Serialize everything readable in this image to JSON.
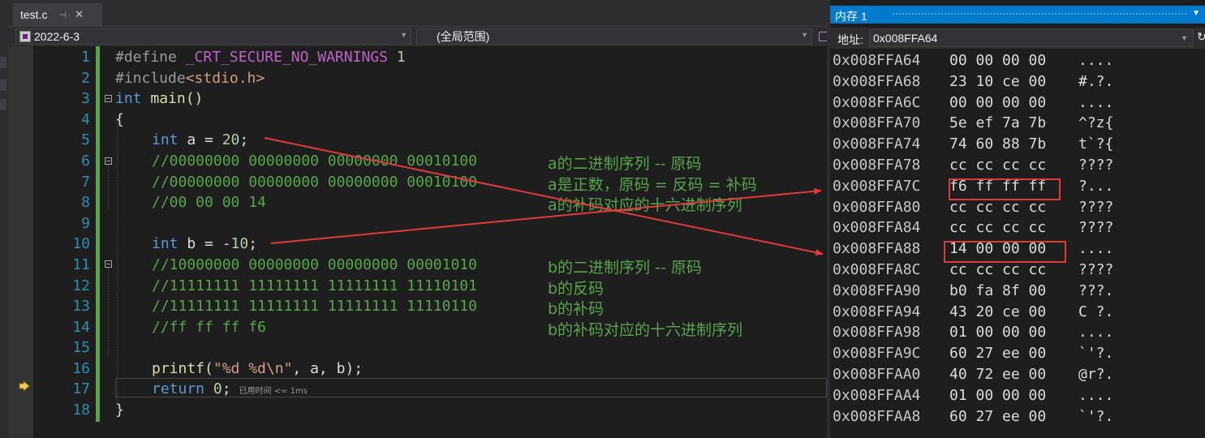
{
  "tab": {
    "filename": "test.c",
    "pin_icon": "pin-icon",
    "close_icon": "close-icon"
  },
  "nav": {
    "project": "2022-6-3",
    "scope": "(全局范围)"
  },
  "editor": {
    "line_numbers": [
      "1",
      "2",
      "3",
      "4",
      "5",
      "6",
      "7",
      "8",
      "9",
      "10",
      "11",
      "12",
      "13",
      "14",
      "15",
      "16",
      "17",
      "18"
    ],
    "lines": {
      "l1_a": "#define ",
      "l1_b": "_CRT_SECURE_NO_WARNINGS",
      "l1_c": " 1",
      "l2_a": "#include",
      "l2_b": "<stdio.h>",
      "l3_a": "int",
      "l3_b": " main()",
      "l4": "{",
      "l5_a": "int",
      "l5_b": " a = ",
      "l5_c": "20",
      "l5_d": ";",
      "l6": "//00000000 00000000 00000000 00010100",
      "l7": "//00000000 00000000 00000000 00010100",
      "l8": "//00 00 00 14",
      "l10_a": "int",
      "l10_b": " b = -",
      "l10_c": "10",
      "l10_d": ";",
      "l11": "//10000000 00000000 00000000 00001010",
      "l12": "//11111111 11111111 11111111 11110101",
      "l13": "//11111111 11111111 11111111 11110110",
      "l14": "//ff ff ff f6",
      "l16_a": "printf",
      "l16_b": "(",
      "l16_c": "\"%d %d\\n\"",
      "l16_d": ", a, b);",
      "l17_a": "return",
      "l17_b": " ",
      "l17_c": "0",
      "l17_d": ";",
      "l18": "}"
    },
    "comments": {
      "c6": "a的二进制序列 -- 原码",
      "c7": "a是正数，原码 = 反码 = 补码",
      "c8": "a的补码对应的十六进制序列",
      "c11": "b的二进制序列 -- 原码",
      "c12": "b的反码",
      "c13": "b的补码",
      "c14": "b的补码对应的十六进制序列"
    },
    "elapsed": "已用时间 <= 1ms"
  },
  "memory": {
    "title": "内存 1",
    "address_label": "地址:",
    "address_value": "0x008FFA64",
    "rows": [
      {
        "addr": "0x008FFA64",
        "hex": "00 00 00 00",
        "chars": "...."
      },
      {
        "addr": "0x008FFA68",
        "hex": "23 10 ce 00",
        "chars": "#.?."
      },
      {
        "addr": "0x008FFA6C",
        "hex": "00 00 00 00",
        "chars": "...."
      },
      {
        "addr": "0x008FFA70",
        "hex": "5e ef 7a 7b",
        "chars": "^?z{"
      },
      {
        "addr": "0x008FFA74",
        "hex": "74 60 88 7b",
        "chars": "t`?{"
      },
      {
        "addr": "0x008FFA78",
        "hex": "cc cc cc cc",
        "chars": "????"
      },
      {
        "addr": "0x008FFA7C",
        "hex": "f6 ff ff ff",
        "chars": "?..."
      },
      {
        "addr": "0x008FFA80",
        "hex": "cc cc cc cc",
        "chars": "????"
      },
      {
        "addr": "0x008FFA84",
        "hex": "cc cc cc cc",
        "chars": "????"
      },
      {
        "addr": "0x008FFA88",
        "hex": "14 00 00 00",
        "chars": "...."
      },
      {
        "addr": "0x008FFA8C",
        "hex": "cc cc cc cc",
        "chars": "????"
      },
      {
        "addr": "0x008FFA90",
        "hex": "b0 fa 8f 00",
        "chars": "???."
      },
      {
        "addr": "0x008FFA94",
        "hex": "43 20 ce 00",
        "chars": "C ?."
      },
      {
        "addr": "0x008FFA98",
        "hex": "01 00 00 00",
        "chars": "...."
      },
      {
        "addr": "0x008FFA9C",
        "hex": "60 27 ee 00",
        "chars": "`'?."
      },
      {
        "addr": "0x008FFAA0",
        "hex": "40 72 ee 00",
        "chars": "@r?."
      },
      {
        "addr": "0x008FFAA4",
        "hex": "01 00 00 00",
        "chars": "...."
      },
      {
        "addr": "0x008FFAA8",
        "hex": "60 27 ee 00",
        "chars": "`'?."
      }
    ]
  },
  "colors": {
    "accent": "#007acc",
    "annotation_red": "#e03a3a",
    "comment_green": "#57a64a",
    "keyword_blue": "#569cd6"
  }
}
